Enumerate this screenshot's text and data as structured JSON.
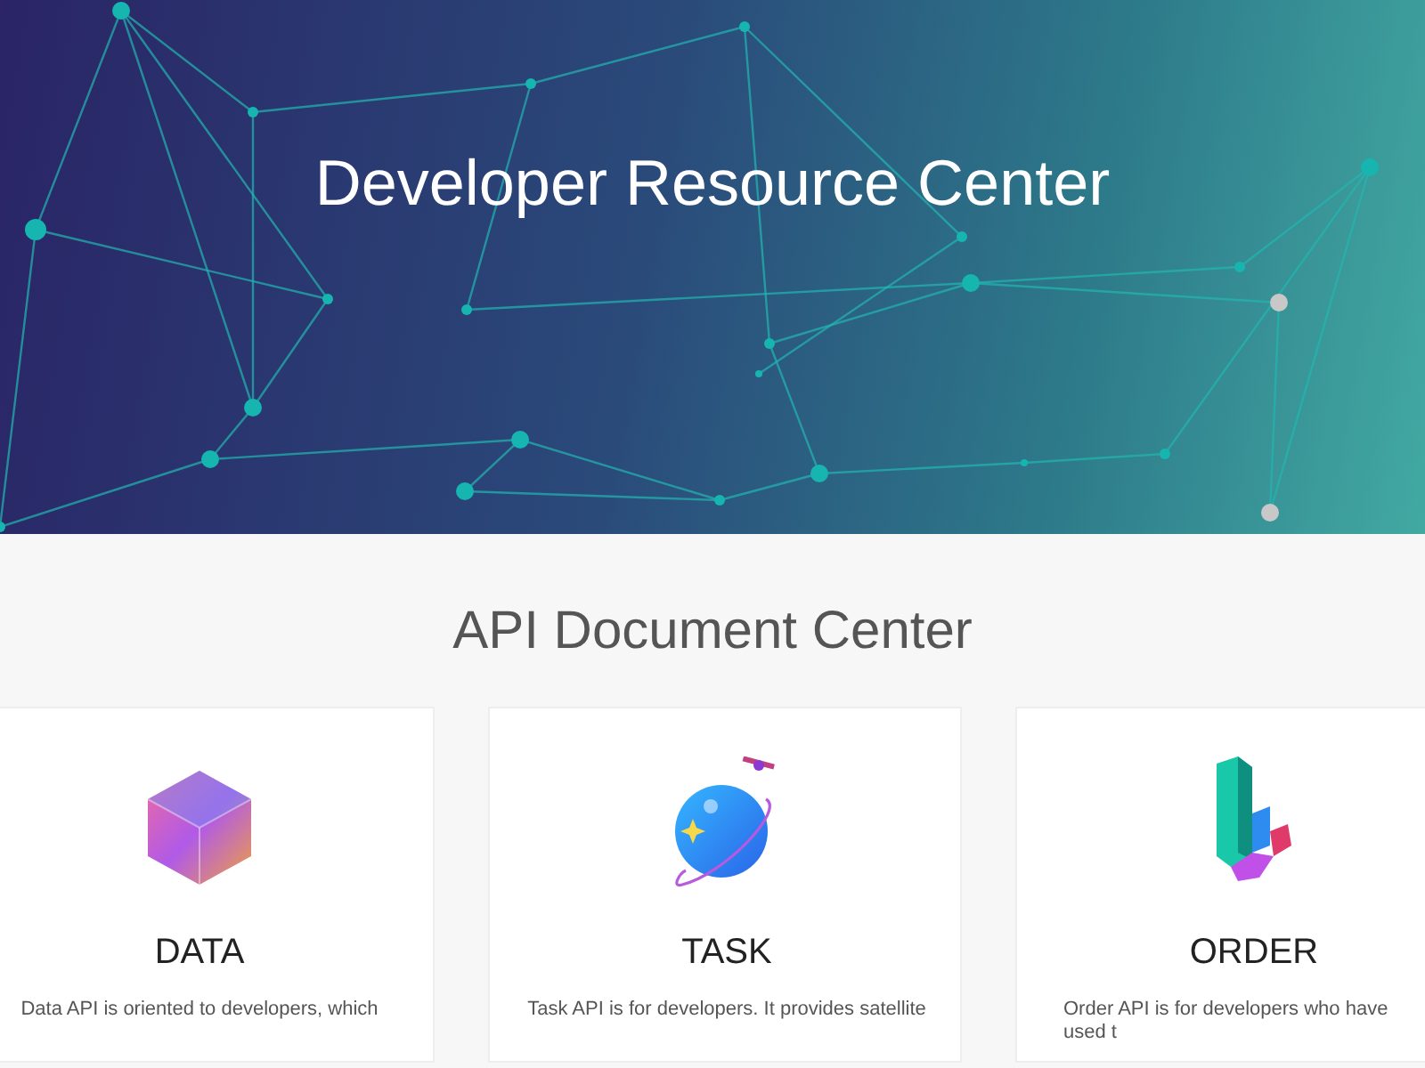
{
  "header": {
    "title": "Developer Resource Center"
  },
  "section": {
    "title": "API Document Center"
  },
  "cards": [
    {
      "kind": "data",
      "title": "DATA",
      "description": "Data API is oriented to developers, which"
    },
    {
      "kind": "task",
      "title": "TASK",
      "description": "Task API is for developers. It provides satellite"
    },
    {
      "kind": "order",
      "title": "ORDER",
      "description": "Order API is for developers who have used t"
    }
  ]
}
